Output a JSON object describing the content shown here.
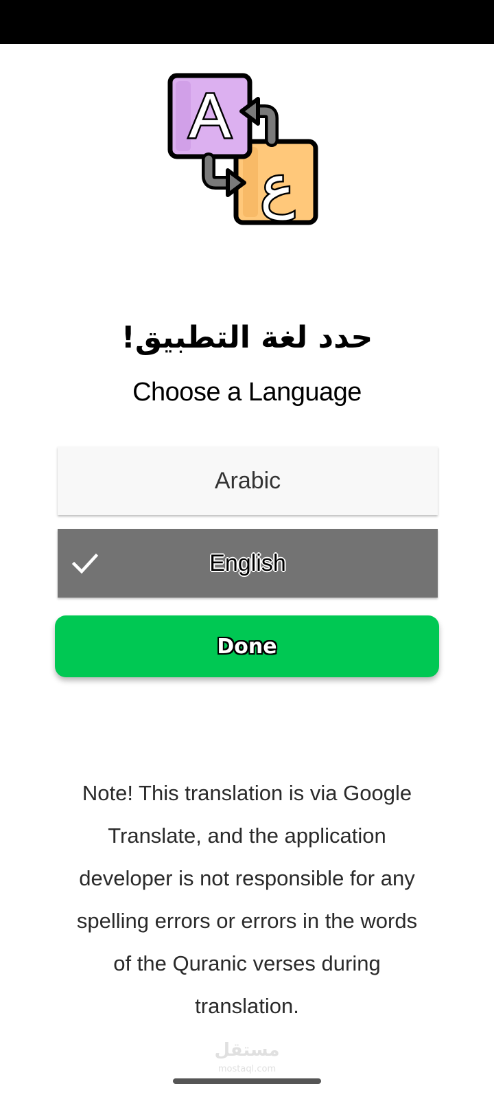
{
  "title_ar": "حدد لغة التطبيق!",
  "title_en": "Choose a Language",
  "options": [
    {
      "label": "Arabic",
      "selected": false
    },
    {
      "label": "English",
      "selected": true
    }
  ],
  "done_label": "Done",
  "note": "Note! This translation is via Google Translate, and the application developer is not responsible for any spelling errors or errors in the words of the Quranic verses during translation.",
  "logo": {
    "letter_latin": "A",
    "letter_arabic": "ع"
  },
  "watermark": {
    "ar": "مستقل",
    "en": "mostaql.com"
  },
  "colors": {
    "done_green": "#00c853",
    "selected_gray": "#737373",
    "unselected_bg": "#f8f8f8",
    "logo_purple": "#dcb0f0",
    "logo_orange": "#ffc87a"
  },
  "icons": {
    "selected": "checkmark-icon",
    "logo": "translate-icon"
  }
}
